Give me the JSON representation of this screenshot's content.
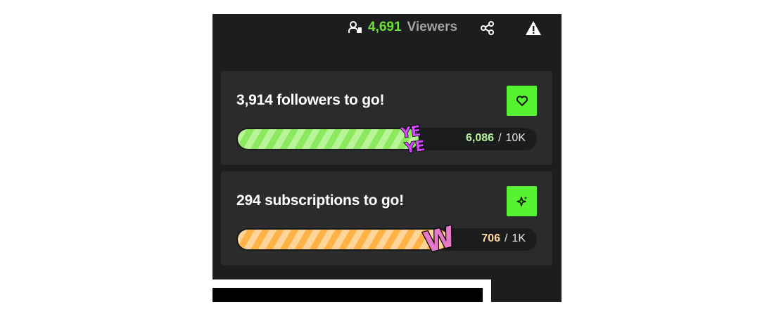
{
  "topbar": {
    "viewer_count": "4,691",
    "viewer_label": "Viewers",
    "viewers_icon": "viewers-icon",
    "share_icon": "share-icon",
    "alert_icon": "warning-icon"
  },
  "goals": [
    {
      "title": "3,914 followers to go!",
      "current": "6,086",
      "separator": "/",
      "target": "10K",
      "progress": 0.6086,
      "button_icon": "heart-icon",
      "emote_text": "YE YE",
      "fill_color": "#8be85f"
    },
    {
      "title": "294 subscriptions to go!",
      "current": "706",
      "separator": "/",
      "target": "1K",
      "progress": 0.706,
      "button_icon": "sparkle-icon",
      "emote_text": "W",
      "fill_color": "#ffb347"
    }
  ],
  "colors": {
    "accent": "#57f232",
    "viewer_count": "#6ee03a",
    "panel_bg": "#1c1d1e",
    "card_bg": "#2a2b2d"
  }
}
